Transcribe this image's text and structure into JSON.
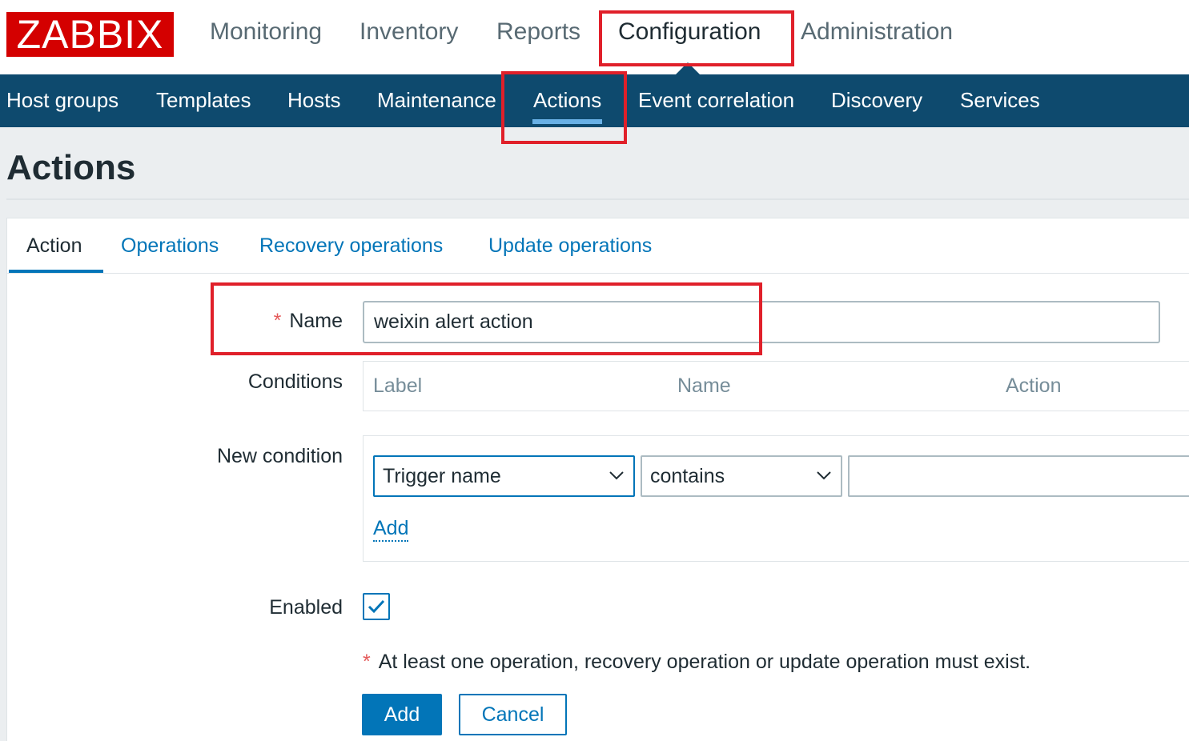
{
  "header": {
    "logo": "ZABBIX",
    "main_menu": [
      {
        "label": "Monitoring"
      },
      {
        "label": "Inventory"
      },
      {
        "label": "Reports"
      },
      {
        "label": "Configuration",
        "active": true
      },
      {
        "label": "Administration"
      }
    ]
  },
  "submenu": [
    {
      "label": "Host groups"
    },
    {
      "label": "Templates"
    },
    {
      "label": "Hosts"
    },
    {
      "label": "Maintenance"
    },
    {
      "label": "Actions",
      "active": true
    },
    {
      "label": "Event correlation"
    },
    {
      "label": "Discovery"
    },
    {
      "label": "Services"
    }
  ],
  "page": {
    "title": "Actions"
  },
  "tabs": [
    {
      "label": "Action",
      "active": true
    },
    {
      "label": "Operations"
    },
    {
      "label": "Recovery operations"
    },
    {
      "label": "Update operations"
    }
  ],
  "form": {
    "required_mark": "*",
    "name_label": "Name",
    "name_value": "weixin alert action",
    "conditions_label": "Conditions",
    "conditions_columns": [
      "Label",
      "Name",
      "Action"
    ],
    "new_condition_label": "New condition",
    "condition_type": "Trigger name",
    "condition_operator": "contains",
    "condition_value": "",
    "add_link": "Add",
    "enabled_label": "Enabled",
    "enabled": true,
    "note": "At least one operation, recovery operation or update operation must exist.",
    "add_button": "Add",
    "cancel_button": "Cancel"
  },
  "colors": {
    "logo": "#d40000",
    "nav_bar": "#0e4a6e",
    "link": "#0275b8",
    "highlight": "#e0202a"
  }
}
